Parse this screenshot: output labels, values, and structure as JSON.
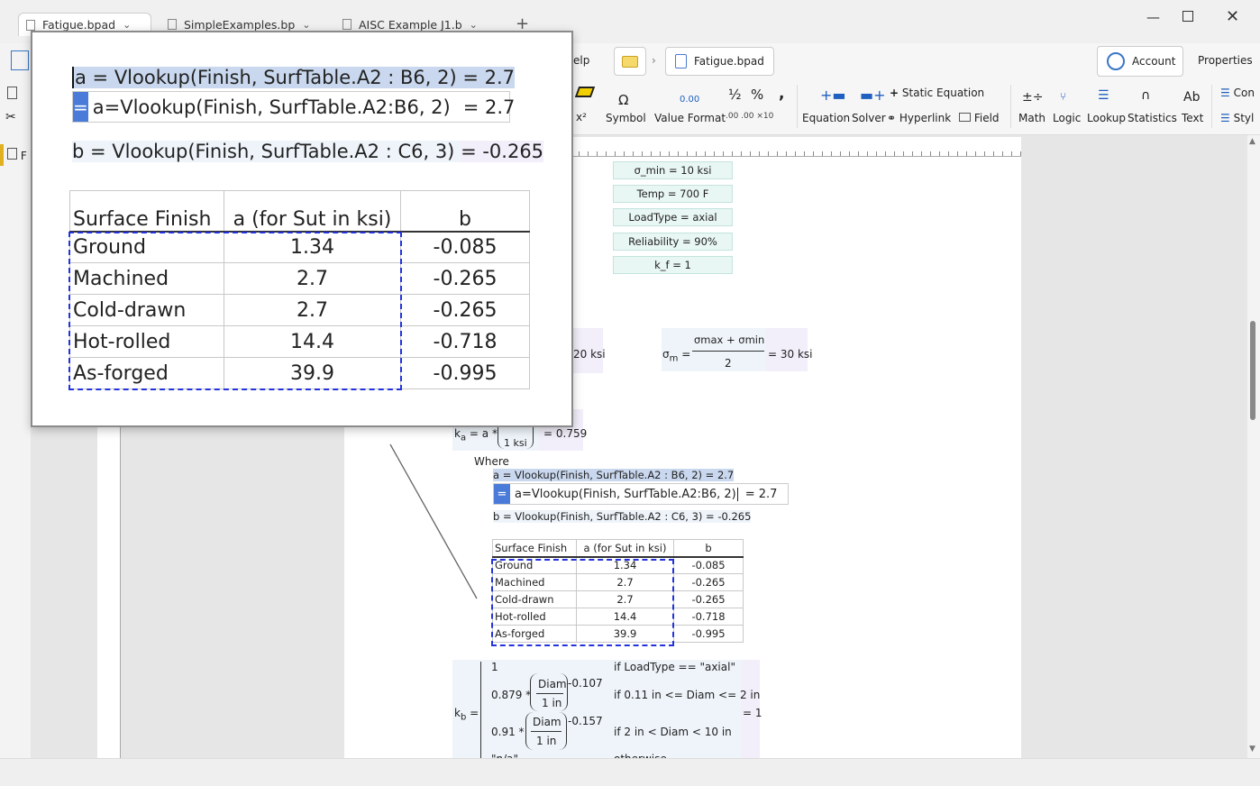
{
  "tabs": [
    {
      "label": "Fatigue.bpad"
    },
    {
      "label": "SimpleExamples.bp"
    },
    {
      "label": "AISC Example J1.b"
    }
  ],
  "toolbar": {
    "help_label": "elp",
    "file_name": "Fatigue.bpad",
    "account_label": "Account",
    "properties_label": "Properties"
  },
  "ribbon": {
    "symbol": "Symbol",
    "value_format": "Value Format",
    "value_glyph": "0.00",
    "half": "½",
    "percent": "%",
    "comma": ",",
    "x2": "x²",
    "omega": "Ω",
    "equation": "Equation",
    "solver": "Solver",
    "static_equation": "Static Equation",
    "hyperlink": "Hyperlink",
    "field": "Field",
    "math": "Math",
    "logic": "Logic",
    "lookup": "Lookup",
    "statistics": "Statistics",
    "text": "Text",
    "ab": "Ab",
    "con": "Con",
    "styl": "Styl"
  },
  "left": {
    "letter": "F"
  },
  "doc": {
    "vars": [
      "σ_min = 10 ksi",
      "Temp = 700 F",
      "LoadType = axial",
      "Reliability = 90%",
      "k_f = 1"
    ],
    "sigma_a_value": "20 ksi",
    "sigma_m": {
      "sigma": "σ",
      "sub": "m",
      "eq": "=",
      "num_max": "σmax",
      "plus": "+",
      "num_min": "σmin",
      "den": "2",
      "result": "= 30 ksi"
    },
    "ka": {
      "lhs": "k",
      "sub": "a",
      "rhs": "= a *",
      "den": "1 ksi",
      "result": "= 0.759"
    },
    "where": "Where",
    "a_line": "a = Vlookup(Finish, SurfTable.A2 : B6, 2) = 2.7",
    "edit_eq": "=",
    "edit_text": "a=Vlookup(Finish, SurfTable.A2:B6, 2)",
    "edit_result": "= 2.7",
    "b_line": "b = Vlookup(Finish, SurfTable.A2 : C6, 3) = -0.265",
    "kb": {
      "lhs": "k",
      "sub": "b",
      "eq": "=",
      "result": "= 1",
      "cases": [
        {
          "expr": "1",
          "cond": "if LoadType == \"axial\""
        },
        {
          "expr": "0.879 *",
          "frac_num": "Diam",
          "frac_den": "1 in",
          "exp": "-0.107",
          "cond": "if 0.11 in <= Diam <= 2 in"
        },
        {
          "expr": "0.91 *",
          "frac_num": "Diam",
          "frac_den": "1 in",
          "exp": "-0.157",
          "cond": "if 2 in < Diam < 10 in"
        },
        {
          "expr": "\"n/a\"",
          "cond": "otherwise"
        }
      ]
    }
  },
  "popup": {
    "a_line": "a = Vlookup(Finish, SurfTable.A2 : B6, 2) = 2.7",
    "edit_eq": "=",
    "edit_text": "a=Vlookup(Finish, SurfTable.A2:B6, 2)",
    "edit_result": "= 2.7",
    "b_line_lhs": "b = Vlookup(Finish, SurfTable.A2 : C6, 3)",
    "b_line_rhs": "= -0.265"
  },
  "table": {
    "headers": [
      "Surface Finish",
      "a (for Sut in ksi)",
      "b"
    ],
    "rows": [
      [
        "Ground",
        "1.34",
        "-0.085"
      ],
      [
        "Machined",
        "2.7",
        "-0.265"
      ],
      [
        "Cold-drawn",
        "2.7",
        "-0.265"
      ],
      [
        "Hot-rolled",
        "14.4",
        "-0.718"
      ],
      [
        "As-forged",
        "39.9",
        "-0.995"
      ]
    ]
  }
}
